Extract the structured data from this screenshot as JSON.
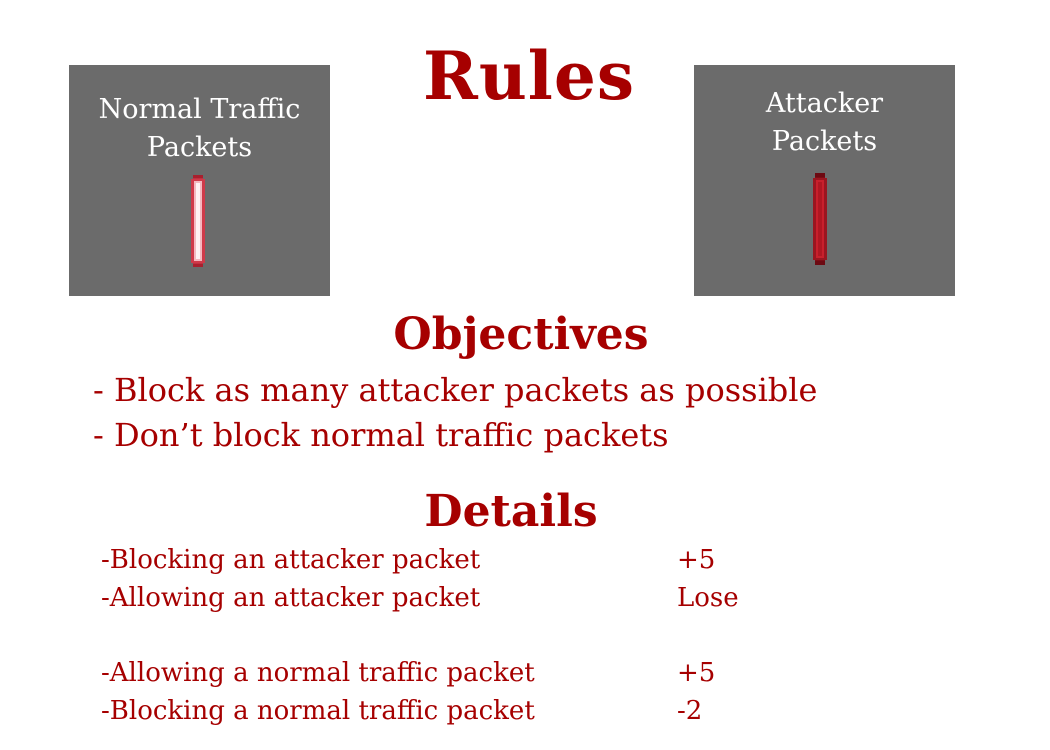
{
  "title": "Rules",
  "panels": {
    "normal": {
      "label": "Normal Traffic\nPackets",
      "packet_icon": "light-red-packet-icon",
      "color": "#e25b6b"
    },
    "attacker": {
      "label": "Attacker\nPackets",
      "packet_icon": "dark-red-packet-icon",
      "color": "#b3151f"
    }
  },
  "objectives": {
    "title": "Objectives",
    "items": [
      "- Block as many attacker packets as possible",
      "- Don’t block normal traffic packets"
    ]
  },
  "details": {
    "title": "Details",
    "rows": [
      {
        "label": "-Blocking an attacker packet",
        "value": "+5"
      },
      {
        "label": "-Allowing an attacker packet",
        "value": "Lose"
      },
      {
        "label": "-Allowing a normal traffic packet",
        "value": "+5"
      },
      {
        "label": "-Blocking a normal traffic packet",
        "value": "-2"
      }
    ]
  },
  "colors": {
    "accent": "#a60000",
    "panel_bg": "#6b6b6b",
    "panel_text": "#ffffff"
  }
}
